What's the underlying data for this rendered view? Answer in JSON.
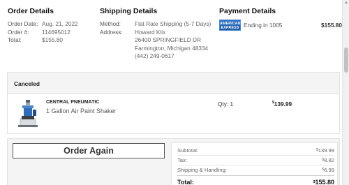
{
  "order_details": {
    "heading": "Order Details",
    "rows": [
      {
        "label": "Order Date:",
        "value": "Aug. 21, 2022"
      },
      {
        "label": "Order #:",
        "value": "114695012"
      },
      {
        "label": "Total:",
        "value": "$155.80"
      }
    ]
  },
  "shipping_details": {
    "heading": "Shipping Details",
    "method_label": "Method:",
    "method_value": "Flat Rate Shipping (5-7 Days)",
    "address_label": "Address:",
    "address_lines": [
      "Howard Klix",
      "26400 SPRINGFIELD DR",
      "Farmington, Michigan 48334",
      "(442) 249-0617"
    ]
  },
  "payment_details": {
    "heading": "Payment Details",
    "card_brand_line1": "AMERICAN",
    "card_brand_line2": "EXPRESS",
    "ending": "Ending in 1005",
    "amount": "$155.80"
  },
  "status": {
    "label": "Canceled"
  },
  "item": {
    "brand": "CENTRAL PNEUMATIC",
    "name": "1 Gallon Air Paint Shaker",
    "qty": "Qty: 1",
    "price_symbol": "$",
    "price_value": "139.99"
  },
  "actions": {
    "order_again": "Order Again"
  },
  "summary": {
    "subtotal_label": "Subtotal:",
    "subtotal_symbol": "$",
    "subtotal_value": "139.99",
    "tax_label": "Tax:",
    "tax_symbol": "$",
    "tax_value": "8.82",
    "shipping_label": "Shipping & Handling:",
    "shipping_symbol": "$",
    "shipping_value": "6.99",
    "total_label": "Total:",
    "total_symbol": "$",
    "total_value": "155.80"
  },
  "colors": {
    "amex_blue": "#2f72c4",
    "panel_bg": "#f4f4f4",
    "border": "#e2e2e2"
  }
}
